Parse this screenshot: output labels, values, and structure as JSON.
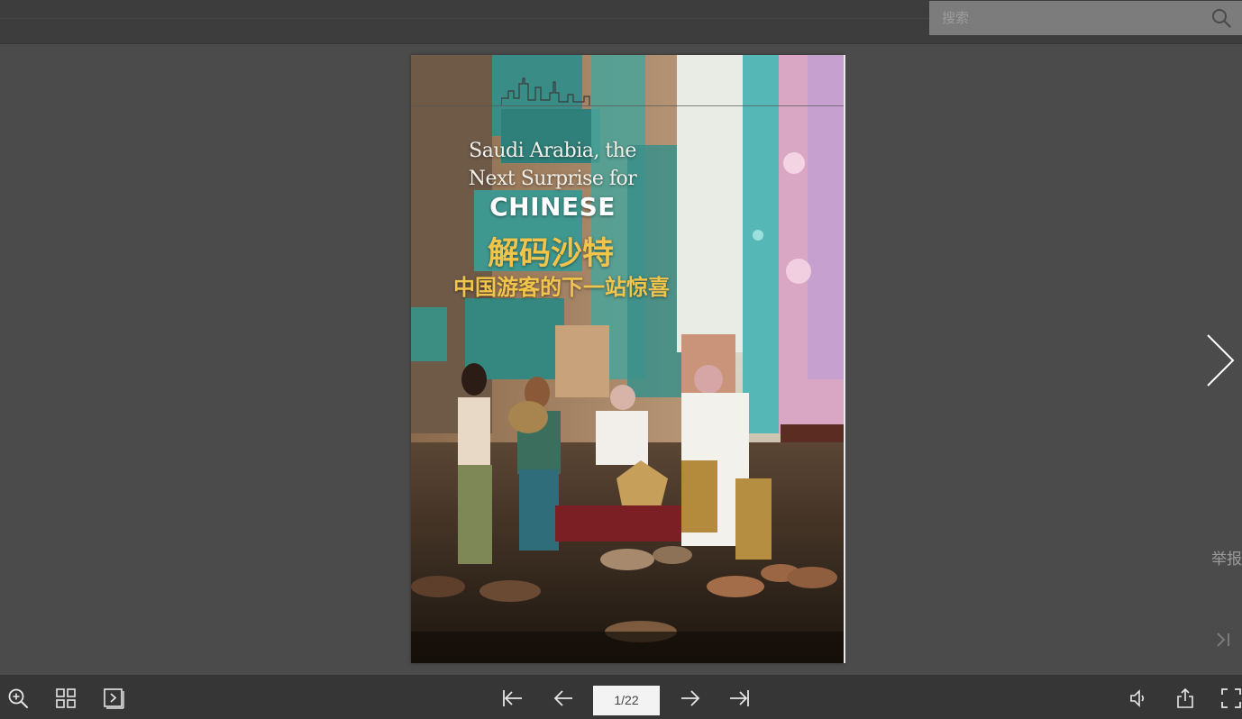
{
  "search": {
    "placeholder": "搜索"
  },
  "cover": {
    "title_en_line1": "Saudi Arabia, the",
    "title_en_line2": "Next Surprise for",
    "title_en_line3": "CHINESE",
    "title_cn_line1": "解码沙特",
    "title_cn_line2": "中国游客的下一站惊喜"
  },
  "side": {
    "report_label": "举报"
  },
  "pager": {
    "current": "1/22"
  },
  "icons": {
    "search": "search-icon",
    "zoom": "zoom-in-icon",
    "thumbs": "grid-icon",
    "autoplay": "play-icon",
    "first": "first-page-icon",
    "prev": "prev-page-icon",
    "next": "next-page-icon",
    "last": "last-page-icon",
    "sound": "speaker-icon",
    "share": "share-icon",
    "fullscreen": "fullscreen-icon"
  }
}
